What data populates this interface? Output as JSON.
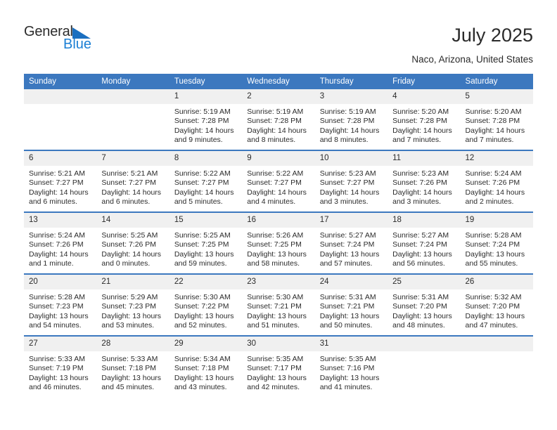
{
  "logo": {
    "word1": "General",
    "word2": "Blue",
    "triangle_color": "#1b6fc0",
    "word2_color": "#1b7fd4"
  },
  "header": {
    "title": "July 2025",
    "subtitle": "Naco, Arizona, United States"
  },
  "theme": {
    "header_bg": "#3c78bf",
    "header_text": "#ffffff",
    "daynum_bg": "#f0f0f0",
    "row_divider": "#3c78bf"
  },
  "weekday_headers": [
    "Sunday",
    "Monday",
    "Tuesday",
    "Wednesday",
    "Thursday",
    "Friday",
    "Saturday"
  ],
  "labels": {
    "sunrise_prefix": "Sunrise:",
    "sunset_prefix": "Sunset:",
    "daylight_prefix": "Daylight:"
  },
  "weeks": [
    [
      {
        "day": "",
        "sunrise": "",
        "sunset": "",
        "daylight": "",
        "blank": true
      },
      {
        "day": "",
        "sunrise": "",
        "sunset": "",
        "daylight": "",
        "blank": true
      },
      {
        "day": "1",
        "sunrise": "Sunrise: 5:19 AM",
        "sunset": "Sunset: 7:28 PM",
        "daylight": "Daylight: 14 hours and 9 minutes."
      },
      {
        "day": "2",
        "sunrise": "Sunrise: 5:19 AM",
        "sunset": "Sunset: 7:28 PM",
        "daylight": "Daylight: 14 hours and 8 minutes."
      },
      {
        "day": "3",
        "sunrise": "Sunrise: 5:19 AM",
        "sunset": "Sunset: 7:28 PM",
        "daylight": "Daylight: 14 hours and 8 minutes."
      },
      {
        "day": "4",
        "sunrise": "Sunrise: 5:20 AM",
        "sunset": "Sunset: 7:28 PM",
        "daylight": "Daylight: 14 hours and 7 minutes."
      },
      {
        "day": "5",
        "sunrise": "Sunrise: 5:20 AM",
        "sunset": "Sunset: 7:28 PM",
        "daylight": "Daylight: 14 hours and 7 minutes."
      }
    ],
    [
      {
        "day": "6",
        "sunrise": "Sunrise: 5:21 AM",
        "sunset": "Sunset: 7:27 PM",
        "daylight": "Daylight: 14 hours and 6 minutes."
      },
      {
        "day": "7",
        "sunrise": "Sunrise: 5:21 AM",
        "sunset": "Sunset: 7:27 PM",
        "daylight": "Daylight: 14 hours and 6 minutes."
      },
      {
        "day": "8",
        "sunrise": "Sunrise: 5:22 AM",
        "sunset": "Sunset: 7:27 PM",
        "daylight": "Daylight: 14 hours and 5 minutes."
      },
      {
        "day": "9",
        "sunrise": "Sunrise: 5:22 AM",
        "sunset": "Sunset: 7:27 PM",
        "daylight": "Daylight: 14 hours and 4 minutes."
      },
      {
        "day": "10",
        "sunrise": "Sunrise: 5:23 AM",
        "sunset": "Sunset: 7:27 PM",
        "daylight": "Daylight: 14 hours and 3 minutes."
      },
      {
        "day": "11",
        "sunrise": "Sunrise: 5:23 AM",
        "sunset": "Sunset: 7:26 PM",
        "daylight": "Daylight: 14 hours and 3 minutes."
      },
      {
        "day": "12",
        "sunrise": "Sunrise: 5:24 AM",
        "sunset": "Sunset: 7:26 PM",
        "daylight": "Daylight: 14 hours and 2 minutes."
      }
    ],
    [
      {
        "day": "13",
        "sunrise": "Sunrise: 5:24 AM",
        "sunset": "Sunset: 7:26 PM",
        "daylight": "Daylight: 14 hours and 1 minute."
      },
      {
        "day": "14",
        "sunrise": "Sunrise: 5:25 AM",
        "sunset": "Sunset: 7:26 PM",
        "daylight": "Daylight: 14 hours and 0 minutes."
      },
      {
        "day": "15",
        "sunrise": "Sunrise: 5:25 AM",
        "sunset": "Sunset: 7:25 PM",
        "daylight": "Daylight: 13 hours and 59 minutes."
      },
      {
        "day": "16",
        "sunrise": "Sunrise: 5:26 AM",
        "sunset": "Sunset: 7:25 PM",
        "daylight": "Daylight: 13 hours and 58 minutes."
      },
      {
        "day": "17",
        "sunrise": "Sunrise: 5:27 AM",
        "sunset": "Sunset: 7:24 PM",
        "daylight": "Daylight: 13 hours and 57 minutes."
      },
      {
        "day": "18",
        "sunrise": "Sunrise: 5:27 AM",
        "sunset": "Sunset: 7:24 PM",
        "daylight": "Daylight: 13 hours and 56 minutes."
      },
      {
        "day": "19",
        "sunrise": "Sunrise: 5:28 AM",
        "sunset": "Sunset: 7:24 PM",
        "daylight": "Daylight: 13 hours and 55 minutes."
      }
    ],
    [
      {
        "day": "20",
        "sunrise": "Sunrise: 5:28 AM",
        "sunset": "Sunset: 7:23 PM",
        "daylight": "Daylight: 13 hours and 54 minutes."
      },
      {
        "day": "21",
        "sunrise": "Sunrise: 5:29 AM",
        "sunset": "Sunset: 7:23 PM",
        "daylight": "Daylight: 13 hours and 53 minutes."
      },
      {
        "day": "22",
        "sunrise": "Sunrise: 5:30 AM",
        "sunset": "Sunset: 7:22 PM",
        "daylight": "Daylight: 13 hours and 52 minutes."
      },
      {
        "day": "23",
        "sunrise": "Sunrise: 5:30 AM",
        "sunset": "Sunset: 7:21 PM",
        "daylight": "Daylight: 13 hours and 51 minutes."
      },
      {
        "day": "24",
        "sunrise": "Sunrise: 5:31 AM",
        "sunset": "Sunset: 7:21 PM",
        "daylight": "Daylight: 13 hours and 50 minutes."
      },
      {
        "day": "25",
        "sunrise": "Sunrise: 5:31 AM",
        "sunset": "Sunset: 7:20 PM",
        "daylight": "Daylight: 13 hours and 48 minutes."
      },
      {
        "day": "26",
        "sunrise": "Sunrise: 5:32 AM",
        "sunset": "Sunset: 7:20 PM",
        "daylight": "Daylight: 13 hours and 47 minutes."
      }
    ],
    [
      {
        "day": "27",
        "sunrise": "Sunrise: 5:33 AM",
        "sunset": "Sunset: 7:19 PM",
        "daylight": "Daylight: 13 hours and 46 minutes."
      },
      {
        "day": "28",
        "sunrise": "Sunrise: 5:33 AM",
        "sunset": "Sunset: 7:18 PM",
        "daylight": "Daylight: 13 hours and 45 minutes."
      },
      {
        "day": "29",
        "sunrise": "Sunrise: 5:34 AM",
        "sunset": "Sunset: 7:18 PM",
        "daylight": "Daylight: 13 hours and 43 minutes."
      },
      {
        "day": "30",
        "sunrise": "Sunrise: 5:35 AM",
        "sunset": "Sunset: 7:17 PM",
        "daylight": "Daylight: 13 hours and 42 minutes."
      },
      {
        "day": "31",
        "sunrise": "Sunrise: 5:35 AM",
        "sunset": "Sunset: 7:16 PM",
        "daylight": "Daylight: 13 hours and 41 minutes."
      },
      {
        "day": "",
        "sunrise": "",
        "sunset": "",
        "daylight": "",
        "blank": true
      },
      {
        "day": "",
        "sunrise": "",
        "sunset": "",
        "daylight": "",
        "blank": true
      }
    ]
  ]
}
